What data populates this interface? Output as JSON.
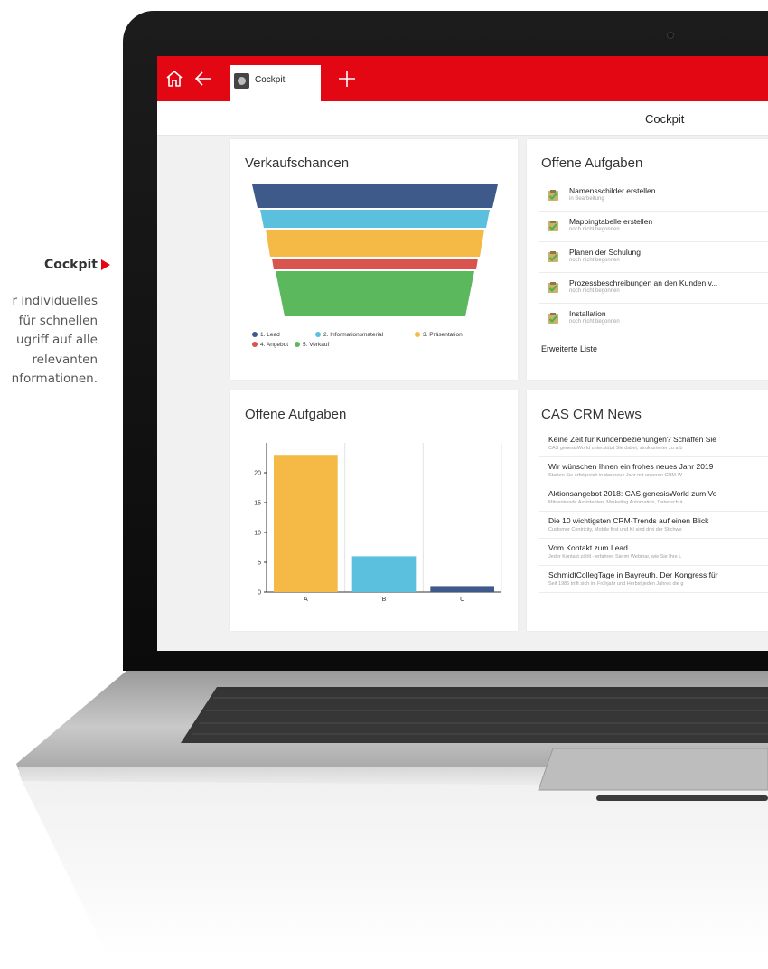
{
  "caption": {
    "title": "Cockpit",
    "lines": [
      "r individuelles",
      "für schnellen",
      "ugriff auf alle",
      "relevanten",
      "nformationen."
    ]
  },
  "colors": {
    "accent": "#e30613",
    "lead": "#3d5a8a",
    "info": "#5bc0de",
    "presentation": "#f5b946",
    "offer": "#d9534f",
    "sale": "#5cb85c"
  },
  "appbar": {
    "home_icon": "home-icon",
    "back_icon": "arrow-left-icon",
    "tab_label": "Cockpit",
    "add_icon": "plus-icon"
  },
  "page": {
    "title": "Cockpit"
  },
  "sales": {
    "title": "Verkaufschancen",
    "legend": [
      {
        "label": "1. Lead",
        "color": "#3d5a8a"
      },
      {
        "label": "2. Informationsmaterial",
        "color": "#5bc0de"
      },
      {
        "label": "3. Präsentation",
        "color": "#f5b946"
      },
      {
        "label": "4. Angebot",
        "color": "#d9534f"
      },
      {
        "label": "5. Verkauf",
        "color": "#5cb85c"
      }
    ]
  },
  "tasks": {
    "title": "Offene Aufgaben",
    "items": [
      {
        "title": "Namensschilder erstellen",
        "status": "in Bearbeitung"
      },
      {
        "title": "Mappingtabelle erstellen",
        "status": "noch nicht begonnen"
      },
      {
        "title": "Planen der Schulung",
        "status": "noch nicht begonnen"
      },
      {
        "title": "Prozessbeschreibungen an den Kunden v...",
        "status": "noch nicht begonnen"
      },
      {
        "title": "Installation",
        "status": "noch nicht begonnen"
      }
    ],
    "more": "Erweiterte Liste"
  },
  "tasks_chart": {
    "title": "Offene Aufgaben"
  },
  "chart_data": {
    "type": "bar",
    "categories": [
      "A",
      "B",
      "C"
    ],
    "values": [
      23,
      6,
      1
    ],
    "colors": [
      "#f5b946",
      "#5bc0de",
      "#3d5a8a"
    ],
    "yticks": [
      0,
      5,
      10,
      15,
      20
    ],
    "ylim": [
      0,
      25
    ]
  },
  "news": {
    "title": "CAS CRM News",
    "items": [
      {
        "title": "Keine Zeit für Kundenbeziehungen? Schaffen Sie",
        "teaser": "CAS genesisWorld unterstützt Sie dabei, strukturierter zu arb"
      },
      {
        "title": "Wir wünschen Ihnen ein frohes neues Jahr 2019",
        "teaser": "Starten Sie erfolgreich in das neue Jahr mit unseren CRM-W"
      },
      {
        "title": "Aktionsangebot 2018: CAS genesisWorld zum Vo",
        "teaser": "Mitdenkende Assistenten, Marketing Automation, Datenschut"
      },
      {
        "title": "Die 10 wichtigsten CRM-Trends auf einen Blick",
        "teaser": "Customer Centricity, Mobile first und KI sind drei der Stichwo"
      },
      {
        "title": "Vom Kontakt zum Lead",
        "teaser": "Jeder Kontakt zählt - erfahren Sie im Webinar, wie Sie Ihre L"
      },
      {
        "title": "SchmidtCollegTage in Bayreuth. Der Kongress für",
        "teaser": "Seit 1985 trifft sich im Frühjahr und Herbst jeden Jahres die g"
      }
    ]
  }
}
